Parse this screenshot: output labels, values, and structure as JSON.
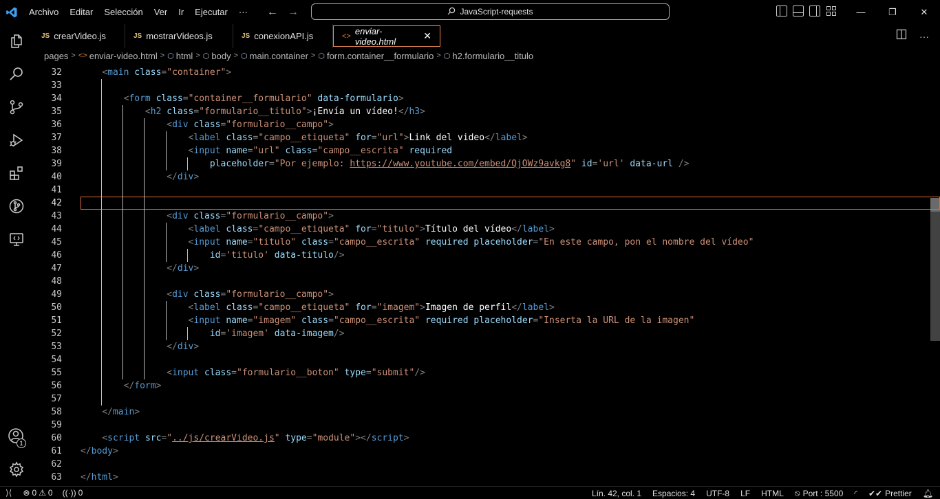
{
  "titlebar": {
    "menu": [
      "Archivo",
      "Editar",
      "Selección",
      "Ver",
      "Ir",
      "Ejecutar",
      "···"
    ],
    "search_text": "JavaScript-requests"
  },
  "tabs": [
    {
      "label": "crearVideo.js",
      "type": "js"
    },
    {
      "label": "mostrarVideos.js",
      "type": "js"
    },
    {
      "label": "conexionAPI.js",
      "type": "js"
    },
    {
      "label": "enviar-video.html",
      "type": "html",
      "active": true
    }
  ],
  "breadcrumb": [
    "pages",
    "enviar-video.html",
    "html",
    "body",
    "main.container",
    "form.container__formulario",
    "h2.formulario__titulo"
  ],
  "editor": {
    "current_line": 42,
    "lines": [
      {
        "n": 32,
        "tokens": [
          [
            "ind",
            "    "
          ],
          [
            "punc",
            "<"
          ],
          [
            "tag",
            "main"
          ],
          [
            "ws",
            " "
          ],
          [
            "attr",
            "class"
          ],
          [
            "punc",
            "="
          ],
          [
            "str",
            "\"container\""
          ],
          [
            "punc",
            ">"
          ]
        ]
      },
      {
        "n": 33,
        "tokens": []
      },
      {
        "n": 34,
        "tokens": [
          [
            "ind",
            "        "
          ],
          [
            "punc",
            "<"
          ],
          [
            "tag",
            "form"
          ],
          [
            "ws",
            " "
          ],
          [
            "attr",
            "class"
          ],
          [
            "punc",
            "="
          ],
          [
            "str",
            "\"container__formulario\""
          ],
          [
            "ws",
            " "
          ],
          [
            "attr",
            "data-formulario"
          ],
          [
            "punc",
            ">"
          ]
        ]
      },
      {
        "n": 35,
        "tokens": [
          [
            "ind",
            "            "
          ],
          [
            "punc",
            "<"
          ],
          [
            "tag",
            "h2"
          ],
          [
            "ws",
            " "
          ],
          [
            "attr",
            "class"
          ],
          [
            "punc",
            "="
          ],
          [
            "str",
            "\"formulario__titulo\""
          ],
          [
            "punc",
            ">"
          ],
          [
            "text",
            "¡Envía un vídeo!"
          ],
          [
            "punc",
            "</"
          ],
          [
            "tag",
            "h3"
          ],
          [
            "punc",
            ">"
          ]
        ]
      },
      {
        "n": 36,
        "tokens": [
          [
            "ind",
            "                "
          ],
          [
            "punc",
            "<"
          ],
          [
            "tag",
            "div"
          ],
          [
            "ws",
            " "
          ],
          [
            "attr",
            "class"
          ],
          [
            "punc",
            "="
          ],
          [
            "str",
            "\"formulario__campo\""
          ],
          [
            "punc",
            ">"
          ]
        ]
      },
      {
        "n": 37,
        "tokens": [
          [
            "ind",
            "                    "
          ],
          [
            "punc",
            "<"
          ],
          [
            "tag",
            "label"
          ],
          [
            "ws",
            " "
          ],
          [
            "attr",
            "class"
          ],
          [
            "punc",
            "="
          ],
          [
            "str",
            "\"campo__etiqueta\""
          ],
          [
            "ws",
            " "
          ],
          [
            "attr",
            "for"
          ],
          [
            "punc",
            "="
          ],
          [
            "str",
            "\"url\""
          ],
          [
            "punc",
            ">"
          ],
          [
            "text",
            "Link del video"
          ],
          [
            "punc",
            "</"
          ],
          [
            "tag",
            "label"
          ],
          [
            "punc",
            ">"
          ]
        ]
      },
      {
        "n": 38,
        "tokens": [
          [
            "ind",
            "                    "
          ],
          [
            "punc",
            "<"
          ],
          [
            "tag",
            "input"
          ],
          [
            "ws",
            " "
          ],
          [
            "attr",
            "name"
          ],
          [
            "punc",
            "="
          ],
          [
            "str",
            "\"url\""
          ],
          [
            "ws",
            " "
          ],
          [
            "attr",
            "class"
          ],
          [
            "punc",
            "="
          ],
          [
            "str",
            "\"campo__escrita\""
          ],
          [
            "ws",
            " "
          ],
          [
            "attr",
            "required"
          ]
        ]
      },
      {
        "n": 39,
        "tokens": [
          [
            "ind",
            "                        "
          ],
          [
            "attr",
            "placeholder"
          ],
          [
            "punc",
            "="
          ],
          [
            "str",
            "\"Por ejemplo: "
          ],
          [
            "link",
            "https://www.youtube.com/embed/QjOWz9avkg8"
          ],
          [
            "str",
            "\""
          ],
          [
            "ws",
            " "
          ],
          [
            "attr",
            "id"
          ],
          [
            "punc",
            "="
          ],
          [
            "str",
            "'url'"
          ],
          [
            "ws",
            " "
          ],
          [
            "attr",
            "data-url"
          ],
          [
            "ws",
            " "
          ],
          [
            "punc",
            "/>"
          ]
        ]
      },
      {
        "n": 40,
        "tokens": [
          [
            "ind",
            "                "
          ],
          [
            "punc",
            "</"
          ],
          [
            "tag",
            "div"
          ],
          [
            "punc",
            ">"
          ]
        ]
      },
      {
        "n": 41,
        "tokens": []
      },
      {
        "n": 42,
        "tokens": []
      },
      {
        "n": 43,
        "tokens": [
          [
            "ind",
            "                "
          ],
          [
            "punc",
            "<"
          ],
          [
            "tag",
            "div"
          ],
          [
            "ws",
            " "
          ],
          [
            "attr",
            "class"
          ],
          [
            "punc",
            "="
          ],
          [
            "str",
            "\"formulario__campo\""
          ],
          [
            "punc",
            ">"
          ]
        ]
      },
      {
        "n": 44,
        "tokens": [
          [
            "ind",
            "                    "
          ],
          [
            "punc",
            "<"
          ],
          [
            "tag",
            "label"
          ],
          [
            "ws",
            " "
          ],
          [
            "attr",
            "class"
          ],
          [
            "punc",
            "="
          ],
          [
            "str",
            "\"campo__etiqueta\""
          ],
          [
            "ws",
            " "
          ],
          [
            "attr",
            "for"
          ],
          [
            "punc",
            "="
          ],
          [
            "str",
            "\"titulo\""
          ],
          [
            "punc",
            ">"
          ],
          [
            "text",
            "Título del vídeo"
          ],
          [
            "punc",
            "</"
          ],
          [
            "tag",
            "label"
          ],
          [
            "punc",
            ">"
          ]
        ]
      },
      {
        "n": 45,
        "tokens": [
          [
            "ind",
            "                    "
          ],
          [
            "punc",
            "<"
          ],
          [
            "tag",
            "input"
          ],
          [
            "ws",
            " "
          ],
          [
            "attr",
            "name"
          ],
          [
            "punc",
            "="
          ],
          [
            "str",
            "\"titulo\""
          ],
          [
            "ws",
            " "
          ],
          [
            "attr",
            "class"
          ],
          [
            "punc",
            "="
          ],
          [
            "str",
            "\"campo__escrita\""
          ],
          [
            "ws",
            " "
          ],
          [
            "attr",
            "required"
          ],
          [
            "ws",
            " "
          ],
          [
            "attr",
            "placeholder"
          ],
          [
            "punc",
            "="
          ],
          [
            "str",
            "\"En este campo, pon el nombre del vídeo\""
          ]
        ]
      },
      {
        "n": 46,
        "tokens": [
          [
            "ind",
            "                        "
          ],
          [
            "attr",
            "id"
          ],
          [
            "punc",
            "="
          ],
          [
            "str",
            "'titulo'"
          ],
          [
            "ws",
            " "
          ],
          [
            "attr",
            "data-titulo"
          ],
          [
            "punc",
            "/>"
          ]
        ]
      },
      {
        "n": 47,
        "tokens": [
          [
            "ind",
            "                "
          ],
          [
            "punc",
            "</"
          ],
          [
            "tag",
            "div"
          ],
          [
            "punc",
            ">"
          ]
        ]
      },
      {
        "n": 48,
        "tokens": []
      },
      {
        "n": 49,
        "tokens": [
          [
            "ind",
            "                "
          ],
          [
            "punc",
            "<"
          ],
          [
            "tag",
            "div"
          ],
          [
            "ws",
            " "
          ],
          [
            "attr",
            "class"
          ],
          [
            "punc",
            "="
          ],
          [
            "str",
            "\"formulario__campo\""
          ],
          [
            "punc",
            ">"
          ]
        ]
      },
      {
        "n": 50,
        "tokens": [
          [
            "ind",
            "                    "
          ],
          [
            "punc",
            "<"
          ],
          [
            "tag",
            "label"
          ],
          [
            "ws",
            " "
          ],
          [
            "attr",
            "class"
          ],
          [
            "punc",
            "="
          ],
          [
            "str",
            "\"campo__etiqueta\""
          ],
          [
            "ws",
            " "
          ],
          [
            "attr",
            "for"
          ],
          [
            "punc",
            "="
          ],
          [
            "str",
            "\"imagem\""
          ],
          [
            "punc",
            ">"
          ],
          [
            "text",
            "Imagen de perfil"
          ],
          [
            "punc",
            "</"
          ],
          [
            "tag",
            "label"
          ],
          [
            "punc",
            ">"
          ]
        ]
      },
      {
        "n": 51,
        "tokens": [
          [
            "ind",
            "                    "
          ],
          [
            "punc",
            "<"
          ],
          [
            "tag",
            "input"
          ],
          [
            "ws",
            " "
          ],
          [
            "attr",
            "name"
          ],
          [
            "punc",
            "="
          ],
          [
            "str",
            "\"imagem\""
          ],
          [
            "ws",
            " "
          ],
          [
            "attr",
            "class"
          ],
          [
            "punc",
            "="
          ],
          [
            "str",
            "\"campo__escrita\""
          ],
          [
            "ws",
            " "
          ],
          [
            "attr",
            "required"
          ],
          [
            "ws",
            " "
          ],
          [
            "attr",
            "placeholder"
          ],
          [
            "punc",
            "="
          ],
          [
            "str",
            "\"Inserta la URL de la imagen\""
          ]
        ]
      },
      {
        "n": 52,
        "tokens": [
          [
            "ind",
            "                        "
          ],
          [
            "attr",
            "id"
          ],
          [
            "punc",
            "="
          ],
          [
            "str",
            "'imagem'"
          ],
          [
            "ws",
            " "
          ],
          [
            "attr",
            "data-imagem"
          ],
          [
            "punc",
            "/>"
          ]
        ]
      },
      {
        "n": 53,
        "tokens": [
          [
            "ind",
            "                "
          ],
          [
            "punc",
            "</"
          ],
          [
            "tag",
            "div"
          ],
          [
            "punc",
            ">"
          ]
        ]
      },
      {
        "n": 54,
        "tokens": []
      },
      {
        "n": 55,
        "tokens": [
          [
            "ind",
            "                "
          ],
          [
            "punc",
            "<"
          ],
          [
            "tag",
            "input"
          ],
          [
            "ws",
            " "
          ],
          [
            "attr",
            "class"
          ],
          [
            "punc",
            "="
          ],
          [
            "str",
            "\"formulario__boton\""
          ],
          [
            "ws",
            " "
          ],
          [
            "attr",
            "type"
          ],
          [
            "punc",
            "="
          ],
          [
            "str",
            "\"submit\""
          ],
          [
            "punc",
            "/>"
          ]
        ]
      },
      {
        "n": 56,
        "tokens": [
          [
            "ind",
            "        "
          ],
          [
            "punc",
            "</"
          ],
          [
            "tag",
            "form"
          ],
          [
            "punc",
            ">"
          ]
        ]
      },
      {
        "n": 57,
        "tokens": []
      },
      {
        "n": 58,
        "tokens": [
          [
            "ind",
            "    "
          ],
          [
            "punc",
            "</"
          ],
          [
            "tag",
            "main"
          ],
          [
            "punc",
            ">"
          ]
        ]
      },
      {
        "n": 59,
        "tokens": []
      },
      {
        "n": 60,
        "tokens": [
          [
            "ind",
            "    "
          ],
          [
            "punc",
            "<"
          ],
          [
            "tag",
            "script"
          ],
          [
            "ws",
            " "
          ],
          [
            "attr",
            "src"
          ],
          [
            "punc",
            "="
          ],
          [
            "str",
            "\""
          ],
          [
            "link",
            "../js/crearVideo.js"
          ],
          [
            "str",
            "\""
          ],
          [
            "ws",
            " "
          ],
          [
            "attr",
            "type"
          ],
          [
            "punc",
            "="
          ],
          [
            "str",
            "\"module\""
          ],
          [
            "punc",
            "></"
          ],
          [
            "tag",
            "script"
          ],
          [
            "punc",
            ">"
          ]
        ]
      },
      {
        "n": 61,
        "tokens": [
          [
            "punc",
            "</"
          ],
          [
            "tag",
            "body"
          ],
          [
            "punc",
            ">"
          ]
        ]
      },
      {
        "n": 62,
        "tokens": []
      },
      {
        "n": 63,
        "tokens": [
          [
            "punc",
            "</"
          ],
          [
            "tag",
            "html"
          ],
          [
            "punc",
            ">"
          ]
        ]
      }
    ]
  },
  "activity_badge": "1",
  "statusbar": {
    "errors": "0",
    "warnings": "0",
    "ports": "0",
    "position": "Lín. 42, col. 1",
    "spaces": "Espacios: 4",
    "encoding": "UTF-8",
    "eol": "LF",
    "language": "HTML",
    "port": "Port : 5500",
    "prettier": "Prettier"
  },
  "colors": {
    "accent_tab_border": "#f28b54",
    "vscode_blue": "#3ea0f2",
    "tag": "#569cd6",
    "attr": "#9cdcfe",
    "string": "#ce9178"
  }
}
